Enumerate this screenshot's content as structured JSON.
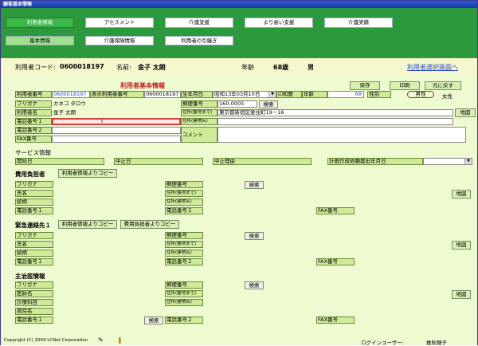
{
  "window_title": "顧客基本情報",
  "tabs": [
    "利用者情報",
    "アセスメント",
    "介護支援",
    "より高い支援",
    "介護実績"
  ],
  "subtabs": [
    "基本情報",
    "介護保険情報",
    "利用者の引継ぎ"
  ],
  "infobar": {
    "code_label": "利用者コード:",
    "code_value": "0600018197",
    "name_label": "名前:",
    "name_value": "金子 太朗",
    "age_label": "年齢",
    "age_value": "68歳",
    "gender_value": "男",
    "select_link": "利用者選択画面へ"
  },
  "section_title": "利用者基本情報",
  "buttons": {
    "save": "保存",
    "print": "印刷",
    "back": "元に戻す",
    "search": "検索",
    "map": "地図",
    "copy_user": "利用者情報よりコピー",
    "copy_payer": "費用負担者よりコピー"
  },
  "user": {
    "num_label": "利用者番号",
    "num_value": "0600018197",
    "disp_label": "表示利用者番号",
    "disp_value": "0600018197",
    "birth_label": "生年月日",
    "birth_value": "昭和13年03月10日",
    "era": "和暦",
    "age_label": "年齢",
    "age_value": "68",
    "gender_label": "性別",
    "male": "男性",
    "female": "女性",
    "furigana_label": "フリガナ",
    "furigana_value": "カネコ タロウ",
    "postal_label": "郵便番号",
    "postal_value": "160-0005",
    "name_label": "利用者名",
    "name_value": "金子 太朗",
    "addr_label": "住所(番地まで)",
    "addr_value": "東京都新宿区愛住町19－16",
    "bldg_label": "住所(建物名)",
    "tel1_label": "電話番号１",
    "tel2_label": "電話番号２",
    "fax_label": "FAX番号",
    "comment_label": "コメント"
  },
  "service": {
    "title": "サービス情報",
    "start": "開始日",
    "stop": "中止日",
    "reason": "中止理由",
    "plan": "計画作成依頼届出年月日"
  },
  "payer": {
    "title": "費用負担者",
    "furigana": "フリガナ",
    "name": "氏名",
    "relation": "続柄",
    "tel1": "電話番号１",
    "postal": "郵便番号",
    "addr": "住所(番地まで)",
    "bldg": "住所(建物名)",
    "tel2": "電話番号２",
    "fax": "FAX番号"
  },
  "emergency": {
    "title": "緊急連絡先１"
  },
  "doctor": {
    "title": "主治医情報",
    "furigana": "フリガナ",
    "name": "医師名",
    "dept": "診療科目",
    "hospital": "病院名",
    "tel1": "電話番号１"
  },
  "footer": {
    "copyright": "Copyright (C) 2004 LCNet Corporation",
    "login_label": "ログインユーザー:",
    "login_value": "推秋穂子"
  },
  "colors": {
    "green": "#2c9a3c",
    "panel": "#eefad0",
    "label": "#cfeb9a"
  }
}
